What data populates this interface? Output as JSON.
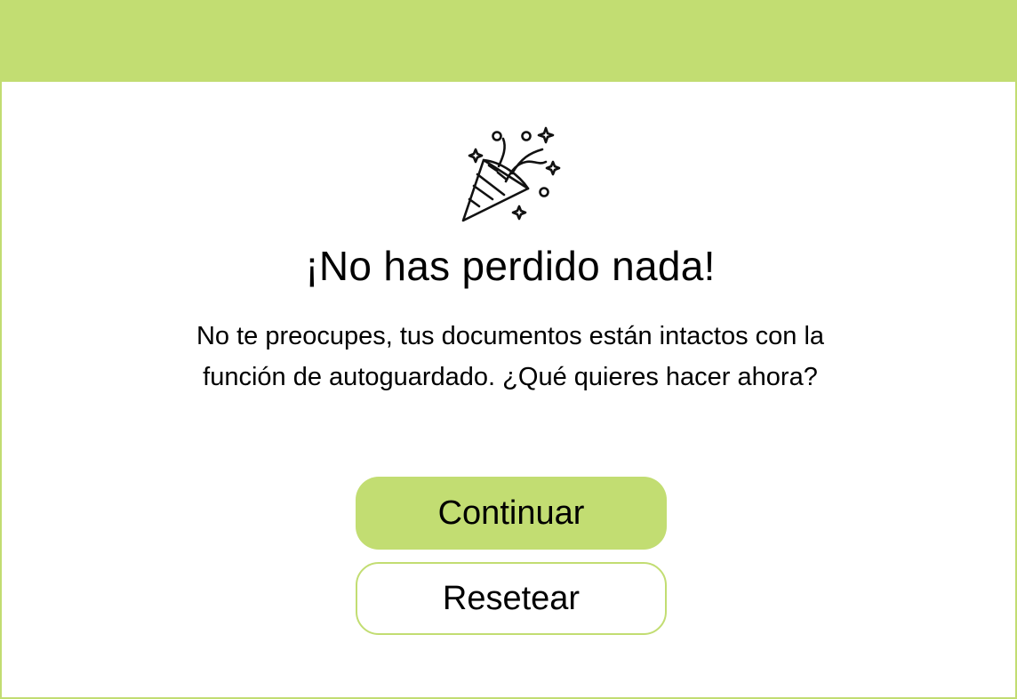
{
  "dialog": {
    "title": "¡No has perdido nada!",
    "message": "No te preocupes, tus documentos están intactos con la función de autoguardado. ¿Qué quieres hacer ahora?",
    "icon": "party-popper-icon"
  },
  "actions": {
    "continue_label": "Continuar",
    "reset_label": "Resetear"
  },
  "colors": {
    "accent": "#c2dd72",
    "background": "#ffffff",
    "text": "#000000"
  }
}
